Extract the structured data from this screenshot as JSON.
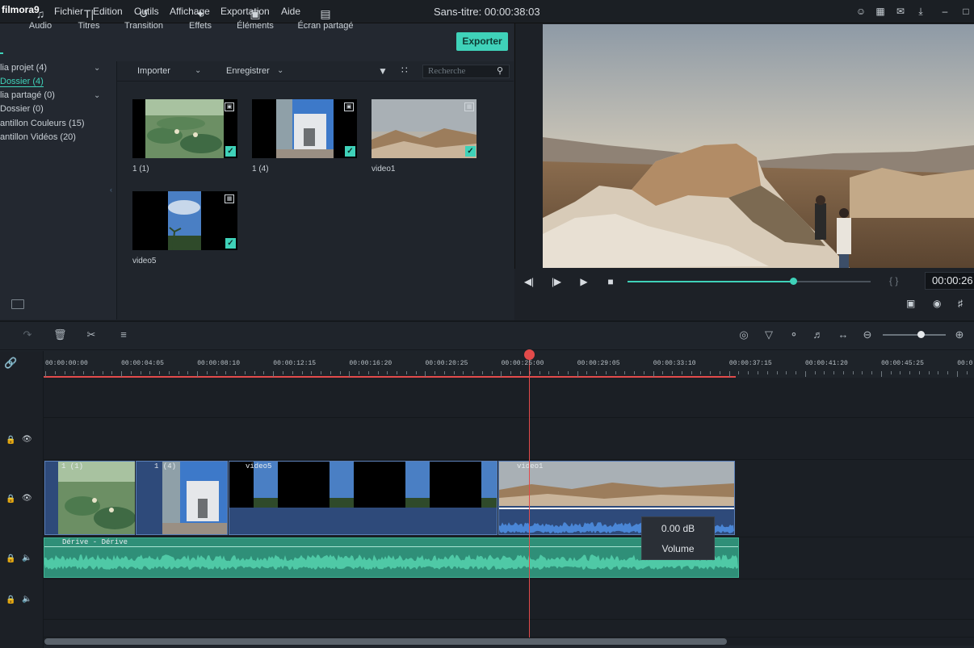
{
  "app": {
    "logo": "filmora9",
    "doc_title": "Sans-titre:",
    "doc_time": "00:00:38:03"
  },
  "menu": [
    "Fichier",
    "Edition",
    "Outils",
    "Affichage",
    "Exportation",
    "Aide"
  ],
  "title_icons": [
    "user-icon",
    "save-icon",
    "mail-icon",
    "download-icon",
    "minimize-icon",
    "maximize-icon"
  ],
  "media_tabs": [
    {
      "label": "Audio",
      "icon": "music-note-icon"
    },
    {
      "label": "Titres",
      "icon": "text-icon"
    },
    {
      "label": "Transition",
      "icon": "transition-icon"
    },
    {
      "label": "Effets",
      "icon": "effects-icon"
    },
    {
      "label": "Éléments",
      "icon": "image-icon"
    },
    {
      "label": "Écran partagé",
      "icon": "split-screen-icon"
    }
  ],
  "export_label": "Exporter",
  "sidebar": [
    {
      "label": "lia projet (4)",
      "active": false
    },
    {
      "label": "Dossier (4)",
      "active": true
    },
    {
      "label": "lia partagé (0)",
      "active": false
    },
    {
      "label": "Dossier (0)",
      "active": false
    },
    {
      "label": "antillon Couleurs (15)",
      "active": false
    },
    {
      "label": "antillon Vidéos (20)",
      "active": false
    }
  ],
  "toolbar": {
    "import": "Importer",
    "record": "Enregistrer",
    "search_placeholder": "Recherche"
  },
  "media_items": [
    {
      "label": "1 (1)",
      "kind": "image"
    },
    {
      "label": "1 (4)",
      "kind": "image"
    },
    {
      "label": "video1",
      "kind": "video"
    },
    {
      "label": "video5",
      "kind": "video"
    }
  ],
  "player": {
    "timecode": "00:00:26",
    "progress": 0.68,
    "brackets": "{ }"
  },
  "ruler_labels": [
    "00:00:00:00",
    "00:00:04:05",
    "00:00:08:10",
    "00:00:12:15",
    "00:00:16:20",
    "00:00:20:25",
    "00:00:25:00",
    "00:00:29:05",
    "00:00:33:10",
    "00:00:37:15",
    "00:00:41:20",
    "00:00:45:25",
    "00:0"
  ],
  "clips": {
    "c1": "1 (1)",
    "c2": "1 (4)",
    "c3": "video5",
    "c4": "video1",
    "audio": "Dérive - Dérive"
  },
  "tooltip": {
    "db": "0.00 dB",
    "label": "Volume"
  },
  "colors": {
    "accent": "#3fd2b9",
    "playhead": "#e34b4b",
    "video_clip": "#2e4a7a",
    "audio_clip": "#2f8f78"
  }
}
